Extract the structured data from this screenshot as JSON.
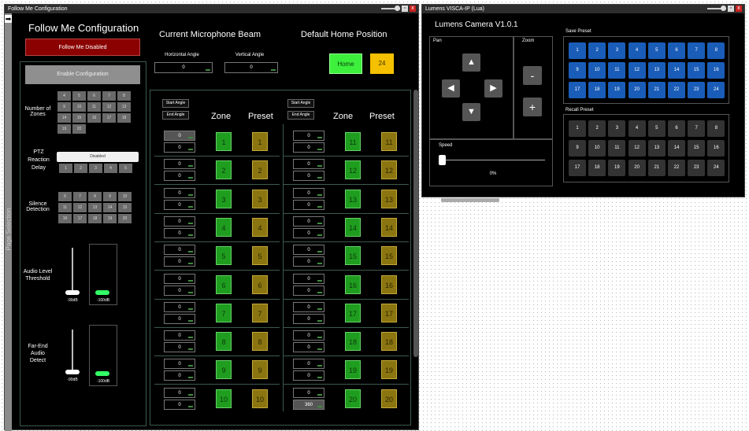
{
  "left_window": {
    "title": "Follow Me Configuration",
    "page_selection": "Page Selection"
  },
  "right_window": {
    "title": "Lumens VISCA-IP (Lua)"
  },
  "fm": {
    "title": "Follow Me Configuration",
    "status_button": "Follow Me Disabled",
    "enable_button": "Enable Configuration",
    "zones_label": "Number of Zones",
    "zone_options": [
      "4",
      "5",
      "6",
      "7",
      "8",
      "9",
      "10",
      "11",
      "12",
      "13",
      "14",
      "15",
      "16",
      "17",
      "18",
      "19",
      "20"
    ],
    "ptz_label": "PTZ Reaction Delay",
    "ptz_value": "Disabled",
    "ptz_options": [
      "1",
      "2",
      "3",
      "4",
      "5"
    ],
    "silence_label": "Silence Detection",
    "silence_options": [
      "6",
      "7",
      "8",
      "9",
      "10",
      "11",
      "12",
      "13",
      "14",
      "15",
      "16",
      "17",
      "18",
      "19",
      "20"
    ],
    "audio_label": "Audio Level Threshold",
    "audio_value": "-90dB",
    "audio_meter": "-100dB",
    "farend_label": "Far-End Audio Detect",
    "farend_value": "-90dB",
    "farend_meter": "-100dB"
  },
  "beam": {
    "title": "Current Microphone Beam",
    "h_label": "Horizontal Angle",
    "h_value": "0",
    "v_label": "Vertical Angle",
    "v_value": "0"
  },
  "home": {
    "title": "Default Home Position",
    "home_button": "Home",
    "preset": "24"
  },
  "zones": {
    "start_label": "Start Angle",
    "end_label": "End Angle",
    "zone_header": "Zone",
    "preset_header": "Preset",
    "rows_left": [
      {
        "start": "0",
        "end": "0",
        "zone": "1",
        "preset": "1"
      },
      {
        "start": "0",
        "end": "0",
        "zone": "2",
        "preset": "2"
      },
      {
        "start": "0",
        "end": "0",
        "zone": "3",
        "preset": "3"
      },
      {
        "start": "0",
        "end": "0",
        "zone": "4",
        "preset": "4"
      },
      {
        "start": "0",
        "end": "0",
        "zone": "5",
        "preset": "5"
      },
      {
        "start": "0",
        "end": "0",
        "zone": "6",
        "preset": "6"
      },
      {
        "start": "0",
        "end": "0",
        "zone": "7",
        "preset": "7"
      },
      {
        "start": "0",
        "end": "0",
        "zone": "8",
        "preset": "8"
      },
      {
        "start": "0",
        "end": "0",
        "zone": "9",
        "preset": "9"
      },
      {
        "start": "0",
        "end": "0",
        "zone": "10",
        "preset": "10"
      }
    ],
    "rows_right": [
      {
        "start": "0",
        "end": "0",
        "zone": "11",
        "preset": "11"
      },
      {
        "start": "0",
        "end": "0",
        "zone": "12",
        "preset": "12"
      },
      {
        "start": "0",
        "end": "0",
        "zone": "13",
        "preset": "13"
      },
      {
        "start": "0",
        "end": "0",
        "zone": "14",
        "preset": "14"
      },
      {
        "start": "0",
        "end": "0",
        "zone": "15",
        "preset": "15"
      },
      {
        "start": "0",
        "end": "0",
        "zone": "16",
        "preset": "16"
      },
      {
        "start": "0",
        "end": "0",
        "zone": "17",
        "preset": "17"
      },
      {
        "start": "0",
        "end": "0",
        "zone": "18",
        "preset": "18"
      },
      {
        "start": "0",
        "end": "0",
        "zone": "19",
        "preset": "19"
      },
      {
        "start": "0",
        "end": "360",
        "zone": "20",
        "preset": "20"
      }
    ]
  },
  "camera": {
    "title": "Lumens Camera V1.0.1",
    "pan_label": "Pan",
    "zoom_label": "Zoom",
    "speed_label": "Speed",
    "speed_value": "0%",
    "zoom_minus": "-",
    "zoom_plus": "+",
    "save_label": "Save Preset",
    "recall_label": "Recall Preset",
    "presets": [
      "1",
      "2",
      "3",
      "4",
      "5",
      "6",
      "7",
      "8",
      "9",
      "10",
      "11",
      "12",
      "13",
      "14",
      "15",
      "16",
      "17",
      "18",
      "19",
      "20",
      "21",
      "22",
      "23",
      "24"
    ]
  },
  "colors": {
    "green": "#1f9d1f",
    "gold": "#8a7510",
    "red": "#8b0000",
    "blue": "#1a5db8",
    "home_green": "#3cf03c",
    "home_yellow": "#f5c000"
  }
}
